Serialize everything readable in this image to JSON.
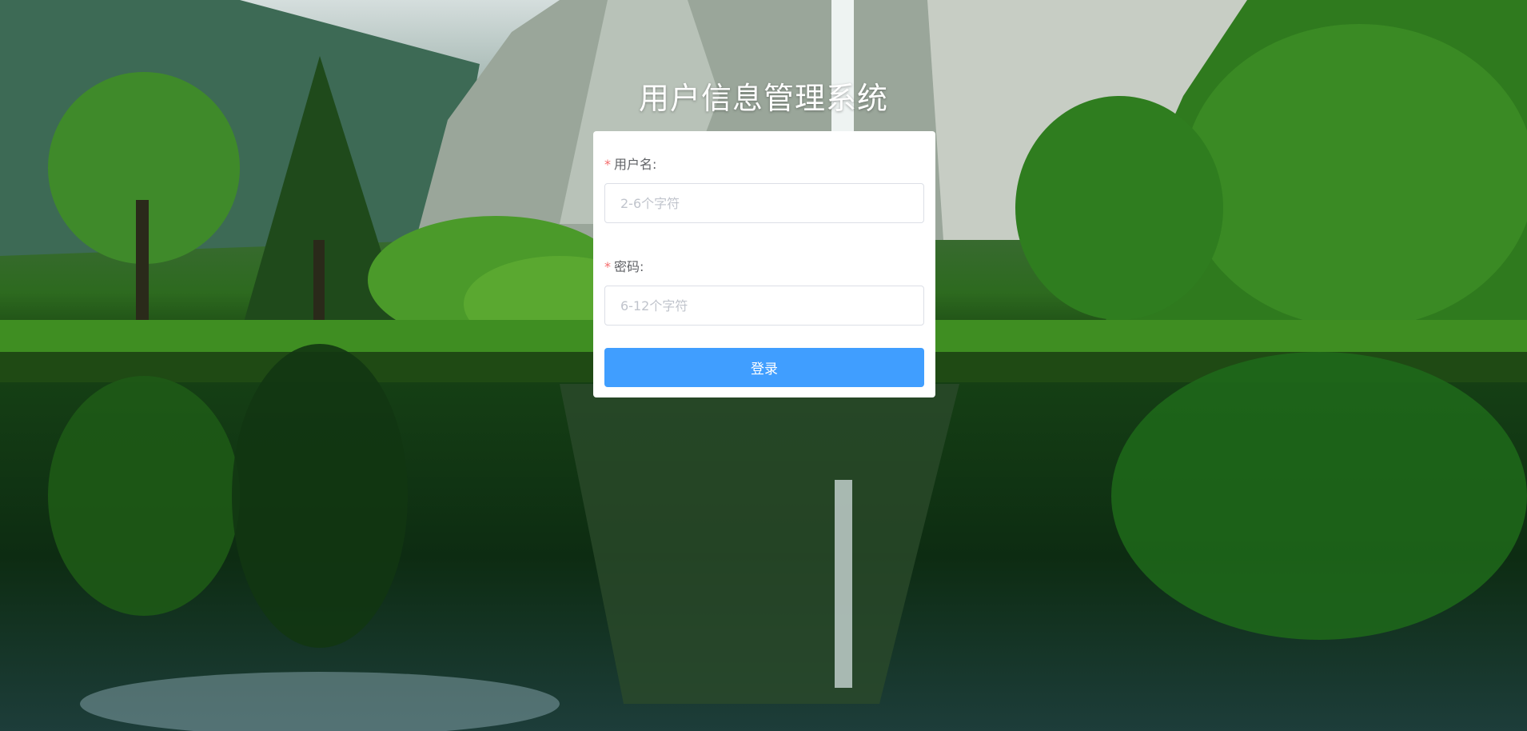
{
  "page": {
    "title": "用户信息管理系统"
  },
  "login_form": {
    "username": {
      "required_mark": "*",
      "label": "用户名:",
      "value": "",
      "placeholder": "2-6个字符"
    },
    "password": {
      "required_mark": "*",
      "label": "密码:",
      "value": "",
      "placeholder": "6-12个字符"
    },
    "submit_label": "登录"
  },
  "colors": {
    "primary_button": "#409eff",
    "required_mark": "#f56c6c",
    "label_text": "#606266",
    "placeholder_text": "#c0c4cc",
    "card_background": "#ffffff"
  },
  "background": {
    "description_icon": "mountain-lake-landscape"
  }
}
